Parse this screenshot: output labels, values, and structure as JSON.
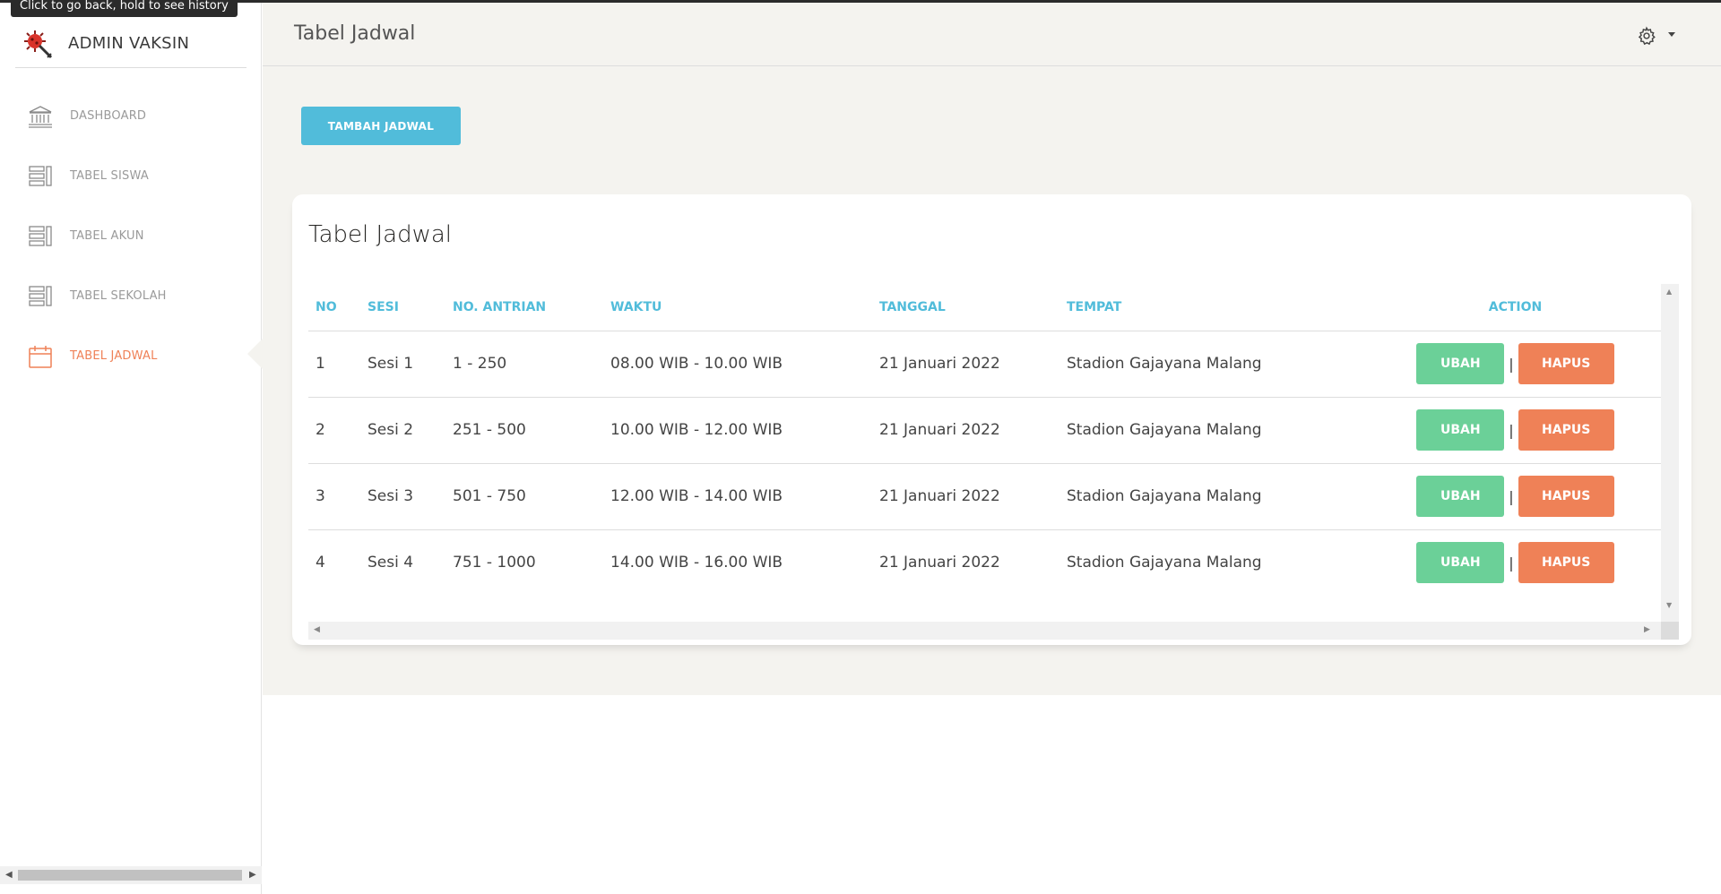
{
  "tooltip": "Click to go back, hold to see history",
  "brand": {
    "title": "ADMIN VAKSIN"
  },
  "sidebar": {
    "items": [
      {
        "label": "DASHBOARD",
        "icon": "bank-icon",
        "active": false
      },
      {
        "label": "TABEL SISWA",
        "icon": "table-list-icon",
        "active": false
      },
      {
        "label": "TABEL AKUN",
        "icon": "table-list-icon",
        "active": false
      },
      {
        "label": "TABEL SEKOLAH",
        "icon": "table-list-icon",
        "active": false
      },
      {
        "label": "TABEL JADWAL",
        "icon": "calendar-icon",
        "active": true
      }
    ]
  },
  "header": {
    "title": "Tabel Jadwal"
  },
  "toolbar": {
    "add_label": "TAMBAH JADWAL"
  },
  "card": {
    "title": "Tabel Jadwal"
  },
  "table": {
    "columns": [
      "NO",
      "SESI",
      "NO. ANTRIAN",
      "WAKTU",
      "TANGGAL",
      "TEMPAT",
      "ACTION"
    ],
    "rows": [
      {
        "no": "1",
        "sesi": "Sesi 1",
        "antrian": "1 - 250",
        "waktu": "08.00 WIB - 10.00 WIB",
        "tanggal": "21 Januari 2022",
        "tempat": "Stadion Gajayana Malang"
      },
      {
        "no": "2",
        "sesi": "Sesi 2",
        "antrian": "251 - 500",
        "waktu": "10.00 WIB - 12.00 WIB",
        "tanggal": "21 Januari 2022",
        "tempat": "Stadion Gajayana Malang"
      },
      {
        "no": "3",
        "sesi": "Sesi 3",
        "antrian": "501 - 750",
        "waktu": "12.00 WIB - 14.00 WIB",
        "tanggal": "21 Januari 2022",
        "tempat": "Stadion Gajayana Malang"
      },
      {
        "no": "4",
        "sesi": "Sesi 4",
        "antrian": "751 - 1000",
        "waktu": "14.00 WIB - 16.00 WIB",
        "tanggal": "21 Januari 2022",
        "tempat": "Stadion Gajayana Malang"
      }
    ],
    "actions": {
      "edit_label": "UBAH",
      "delete_label": "HAPUS",
      "separator": "|"
    }
  },
  "colors": {
    "accent_info": "#51bcda",
    "accent_success": "#6bd098",
    "accent_danger": "#ef8157",
    "background": "#f4f3ef"
  }
}
